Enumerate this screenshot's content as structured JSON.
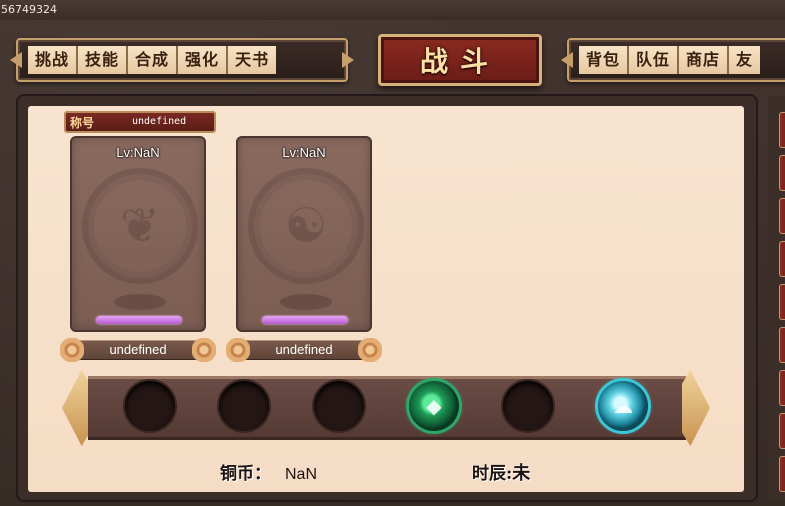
{
  "top_id": "56749324",
  "menu_left": [
    "挑战",
    "技能",
    "合成",
    "强化",
    "天书"
  ],
  "battle_tab": "战斗",
  "menu_right": [
    "背包",
    "队伍",
    "商店",
    "友"
  ],
  "title_label": "称号",
  "title_value": "undefined",
  "heroes": [
    {
      "level": "Lv:NaN",
      "name": "undefined",
      "emblem_icon": "phoenix-emblem"
    },
    {
      "level": "Lv:NaN",
      "name": "undefined",
      "emblem_icon": "dragon-emblem"
    }
  ],
  "slots": [
    {
      "state": "empty"
    },
    {
      "state": "empty"
    },
    {
      "state": "empty"
    },
    {
      "state": "green-gem",
      "icon": "green-jade-icon"
    },
    {
      "state": "empty"
    },
    {
      "state": "cyan-gem",
      "icon": "cloud-orb-icon"
    }
  ],
  "currency_label": "铜币：",
  "currency_value": "NaN",
  "time_label": "时辰:",
  "time_value": "未",
  "colors": {
    "panel_bg": "#f8e4cf",
    "battle_tab": "#8a2a21",
    "gold_border": "#c6a06a",
    "progress_bar": "#c97ae0"
  }
}
